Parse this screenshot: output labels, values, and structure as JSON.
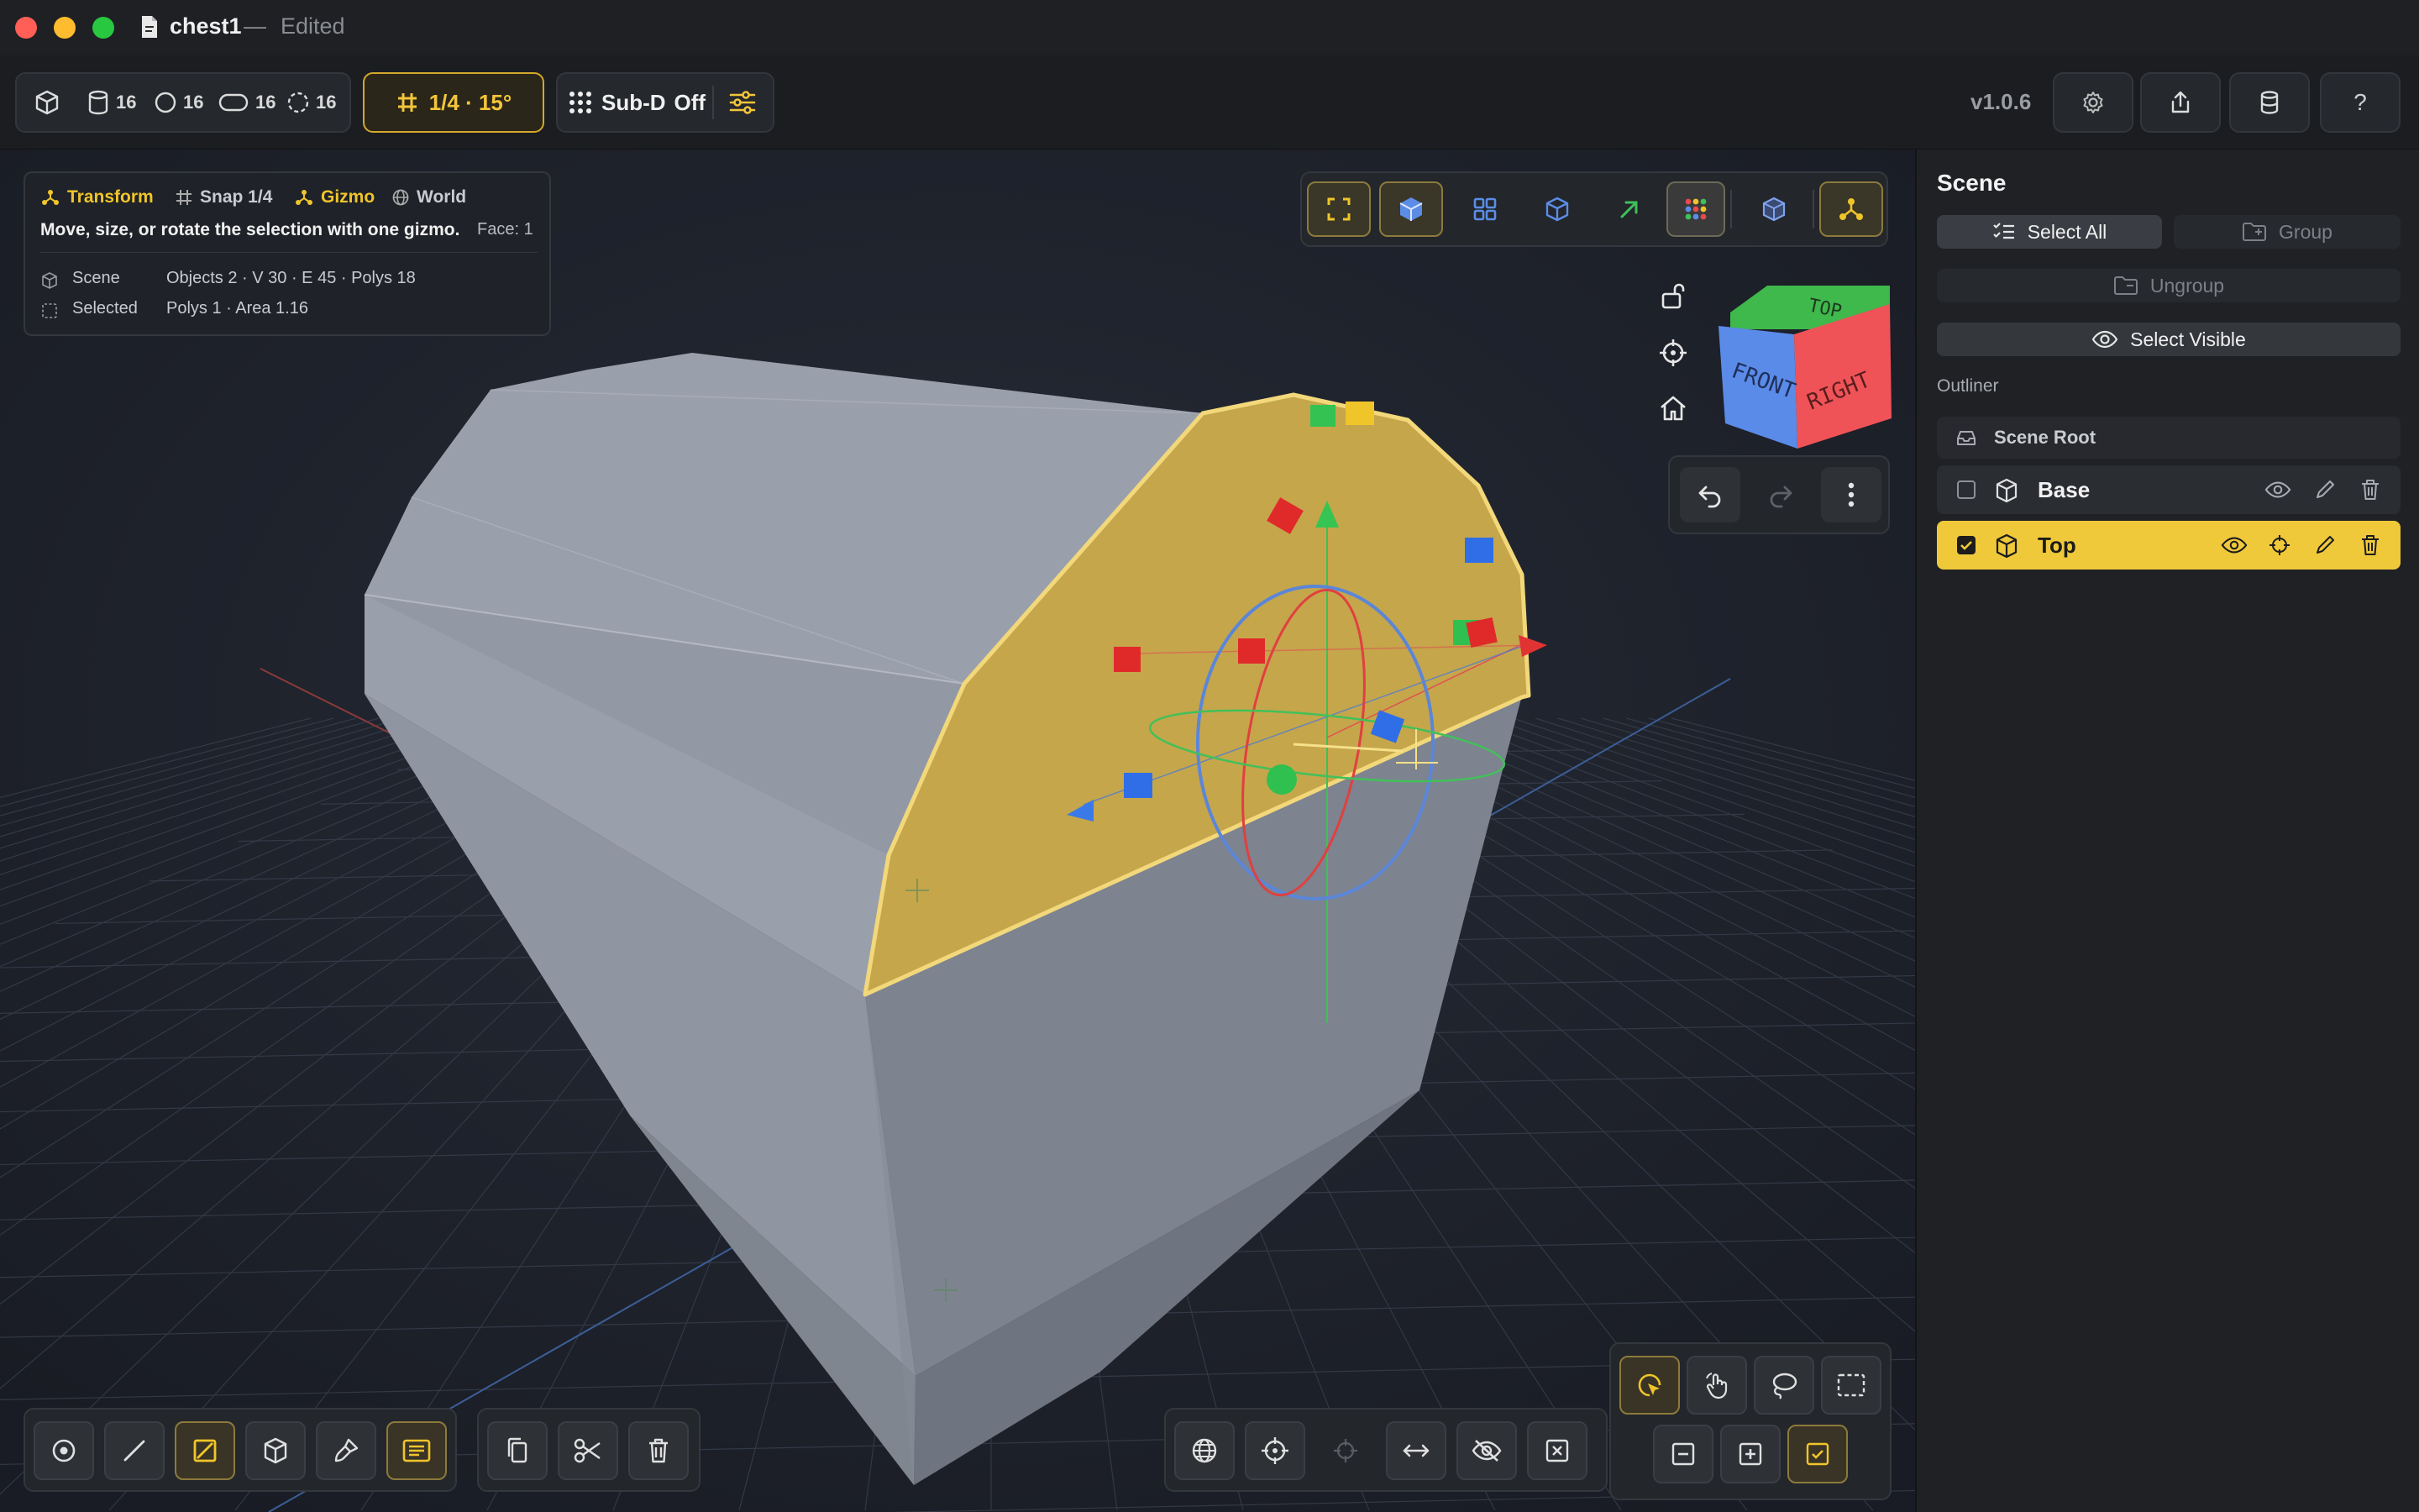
{
  "window": {
    "title": "chest1",
    "separator": "—",
    "status": "Edited"
  },
  "toolbar": {
    "primitives": [
      {
        "icon": "cube-icon",
        "count": ""
      },
      {
        "icon": "cylinder-icon",
        "count": "16"
      },
      {
        "icon": "sphere-icon",
        "count": "16"
      },
      {
        "icon": "torus-icon",
        "count": "16"
      },
      {
        "icon": "circle-dashed-icon",
        "count": "16"
      }
    ],
    "snap_label": "1/4 · 15°",
    "subd_label": "Sub-D",
    "subd_state": "Off",
    "version": "v1.0.6",
    "help_label": "?"
  },
  "info": {
    "tags": {
      "transform": "Transform",
      "snap": "Snap 1/4",
      "gizmo": "Gizmo",
      "world": "World"
    },
    "help_text": "Move, size, or rotate the selection with one gizmo.",
    "face": "Face: 1",
    "scene_key": "Scene",
    "scene_val": "Objects 2 · V 30 · E 45 · Polys 18",
    "selected_key": "Selected",
    "selected_val": "Polys 1 · Area 1.16"
  },
  "viewcube": {
    "top": "TOP",
    "front": "FRONT",
    "right": "RIGHT"
  },
  "sidebar": {
    "title": "Scene",
    "select_all": "Select All",
    "group": "Group",
    "ungroup": "Ungroup",
    "select_visible": "Select Visible",
    "outliner_label": "Outliner",
    "scene_root": "Scene Root",
    "objects": [
      {
        "name": "Base",
        "selected": false
      },
      {
        "name": "Top",
        "selected": true
      }
    ]
  },
  "colors": {
    "accent": "#f0c93a",
    "selection_face": "#c9a94a",
    "axis_x": "#e03030",
    "axis_y": "#22c040",
    "axis_z": "#2f6fe0",
    "mesh": "#a4a9b4"
  }
}
